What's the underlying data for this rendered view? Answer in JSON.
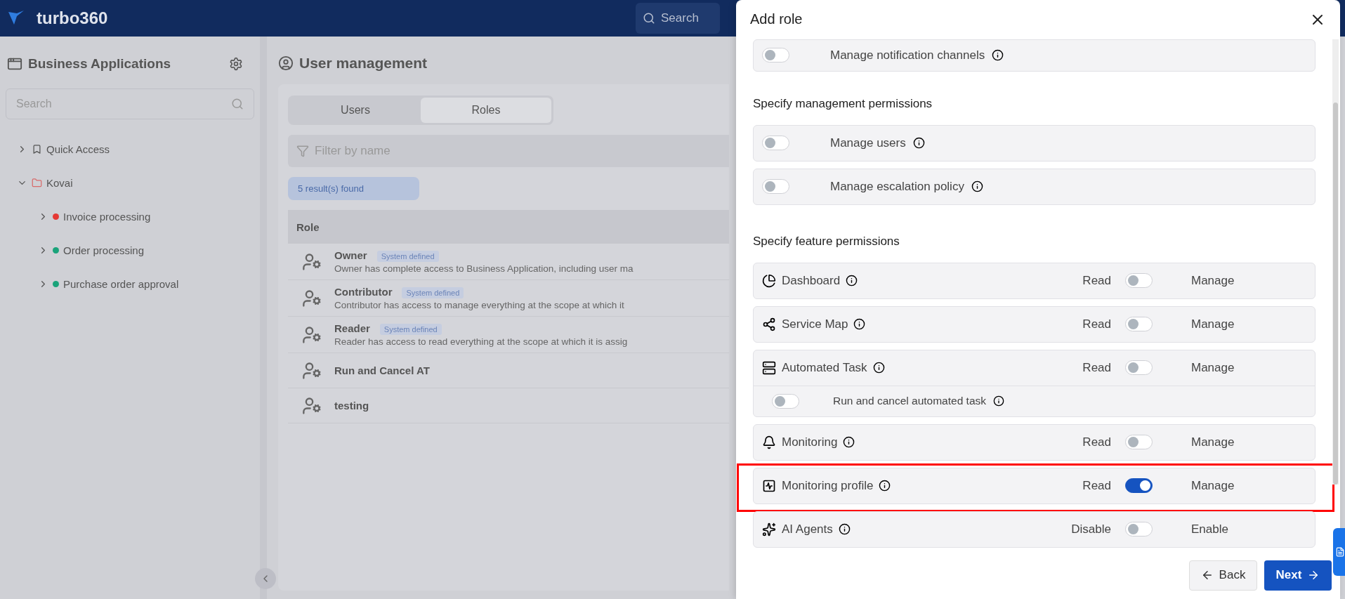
{
  "header": {
    "logo_text": "turbo360",
    "search_placeholder": "Search"
  },
  "sidebar": {
    "title": "Business Applications",
    "search_placeholder": "Search",
    "tree": [
      {
        "label": "Quick Access",
        "expanded": false
      },
      {
        "label": "Kovai",
        "expanded": true,
        "children": [
          {
            "label": "Invoice processing",
            "color": "#e53935",
            "expanded": false
          },
          {
            "label": "Order processing",
            "color": "#1aa37a",
            "expanded": false
          },
          {
            "label": "Purchase order approval",
            "color": "#1aa37a",
            "expanded": false
          }
        ]
      }
    ]
  },
  "main": {
    "title": "User management",
    "tabs": [
      {
        "label": "Users",
        "selected": false
      },
      {
        "label": "Roles",
        "selected": true
      }
    ],
    "filter_placeholder": "Filter by name",
    "result_count": "5 result(s) found",
    "table": {
      "columns": [
        "Role"
      ],
      "rows": [
        {
          "name": "Owner",
          "badge": "System defined",
          "description": "Owner has complete access to Business Application, including user ma"
        },
        {
          "name": "Contributor",
          "badge": "System defined",
          "description": "Contributor has access to manage everything at the scope at which it"
        },
        {
          "name": "Reader",
          "badge": "System defined",
          "description": "Reader has access to read everything at the scope at which it is assig"
        },
        {
          "name": "Run and Cancel AT"
        },
        {
          "name": "testing"
        }
      ]
    }
  },
  "drawer": {
    "title": "Add role",
    "top_rows": [
      {
        "label": "Manage notification channels",
        "on": false
      }
    ],
    "management": {
      "heading": "Specify management permissions",
      "rows": [
        {
          "label": "Manage users",
          "on": false
        },
        {
          "label": "Manage escalation policy",
          "on": false
        }
      ]
    },
    "features": {
      "heading": "Specify feature permissions",
      "rows": [
        {
          "label": "Dashboard",
          "off_label": "Read",
          "on_label": "Manage",
          "on": false,
          "highlighted": false
        },
        {
          "label": "Service Map",
          "off_label": "Read",
          "on_label": "Manage",
          "on": false,
          "highlighted": false
        },
        {
          "label": "Automated Task",
          "off_label": "Read",
          "on_label": "Manage",
          "on": false,
          "highlighted": false,
          "sub_rows": [
            {
              "label": "Run and cancel automated task",
              "on": false
            }
          ]
        },
        {
          "label": "Monitoring",
          "off_label": "Read",
          "on_label": "Manage",
          "on": false,
          "highlighted": false
        },
        {
          "label": "Monitoring profile",
          "off_label": "Read",
          "on_label": "Manage",
          "on": true,
          "highlighted": true
        },
        {
          "label": "AI Agents",
          "off_label": "Disable",
          "on_label": "Enable",
          "on": false,
          "highlighted": false
        }
      ]
    },
    "back_button": "Back",
    "next_button": "Next"
  }
}
